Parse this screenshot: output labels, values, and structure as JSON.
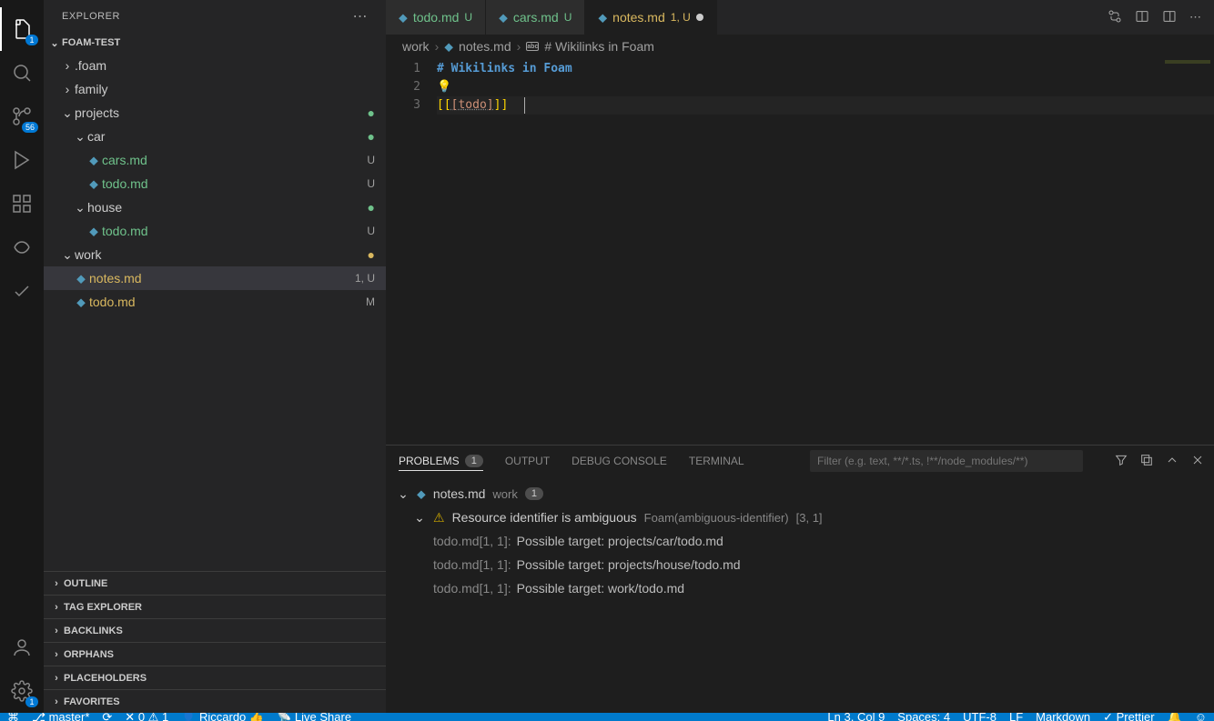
{
  "sidebar": {
    "title": "EXPLORER",
    "workspace": "FOAM-TEST",
    "tree": [
      {
        "label": ".foam",
        "type": "folder",
        "indent": 1,
        "expanded": false,
        "git": ""
      },
      {
        "label": "family",
        "type": "folder",
        "indent": 1,
        "expanded": false,
        "git": ""
      },
      {
        "label": "projects",
        "type": "folder",
        "indent": 1,
        "expanded": true,
        "git": "dot"
      },
      {
        "label": "car",
        "type": "folder",
        "indent": 2,
        "expanded": true,
        "git": "dot"
      },
      {
        "label": "cars.md",
        "type": "file",
        "indent": 3,
        "git": "U",
        "gitClass": "git-untracked"
      },
      {
        "label": "todo.md",
        "type": "file",
        "indent": 3,
        "git": "U",
        "gitClass": "git-untracked"
      },
      {
        "label": "house",
        "type": "folder",
        "indent": 2,
        "expanded": true,
        "git": "dot"
      },
      {
        "label": "todo.md",
        "type": "file",
        "indent": 3,
        "git": "U",
        "gitClass": "git-untracked"
      },
      {
        "label": "work",
        "type": "folder",
        "indent": 1,
        "expanded": true,
        "git": "dot-mod"
      },
      {
        "label": "notes.md",
        "type": "file",
        "indent": 2,
        "git": "1, U",
        "gitClass": "git-modified",
        "selected": true
      },
      {
        "label": "todo.md",
        "type": "file",
        "indent": 2,
        "git": "M",
        "gitClass": "git-modified"
      }
    ],
    "sections": [
      "OUTLINE",
      "TAG EXPLORER",
      "BACKLINKS",
      "ORPHANS",
      "PLACEHOLDERS",
      "FAVORITES"
    ]
  },
  "activity": {
    "explorer_badge": "1",
    "scm_badge": "56",
    "settings_badge": "1"
  },
  "tabs": [
    {
      "label": "todo.md",
      "status": "U",
      "statusClass": "git-untracked",
      "active": false
    },
    {
      "label": "cars.md",
      "status": "U",
      "statusClass": "git-untracked",
      "active": false
    },
    {
      "label": "notes.md",
      "status": "1, U",
      "statusClass": "git-modified",
      "active": true,
      "dirty": true
    }
  ],
  "breadcrumb": {
    "part1": "work",
    "part2": "notes.md",
    "part3": "# Wikilinks in Foam"
  },
  "editor": {
    "lines": [
      "1",
      "2",
      "3"
    ],
    "line1_text": "# Wikilinks in Foam",
    "line3_open": "[[",
    "line3_mid": "[todo]",
    "line3_close": "]]",
    "bulb": "💡"
  },
  "panel": {
    "tabs": {
      "problems": "PROBLEMS",
      "output": "OUTPUT",
      "debug": "DEBUG CONSOLE",
      "terminal": "TERMINAL"
    },
    "problems_count": "1",
    "filter_placeholder": "Filter (e.g. text, **/*.ts, !**/node_modules/**)",
    "file": "notes.md",
    "folder": "work",
    "file_count": "1",
    "warning_text": "Resource identifier is ambiguous",
    "warning_source": "Foam(ambiguous-identifier)",
    "warning_loc": "[3, 1]",
    "targets": [
      {
        "name": "todo.md",
        "pos": "[1, 1]:",
        "msg": "Possible target: projects/car/todo.md"
      },
      {
        "name": "todo.md",
        "pos": "[1, 1]:",
        "msg": "Possible target: projects/house/todo.md"
      },
      {
        "name": "todo.md",
        "pos": "[1, 1]:",
        "msg": "Possible target: work/todo.md"
      }
    ]
  },
  "statusbar": {
    "branch": "master*",
    "errors": "0",
    "warnings": "1",
    "user": "Riccardo",
    "liveshare": "Live Share",
    "cursor": "Ln 3, Col 9",
    "spaces": "Spaces: 4",
    "encoding": "UTF-8",
    "eol": "LF",
    "lang": "Markdown",
    "prettier": "Prettier"
  }
}
